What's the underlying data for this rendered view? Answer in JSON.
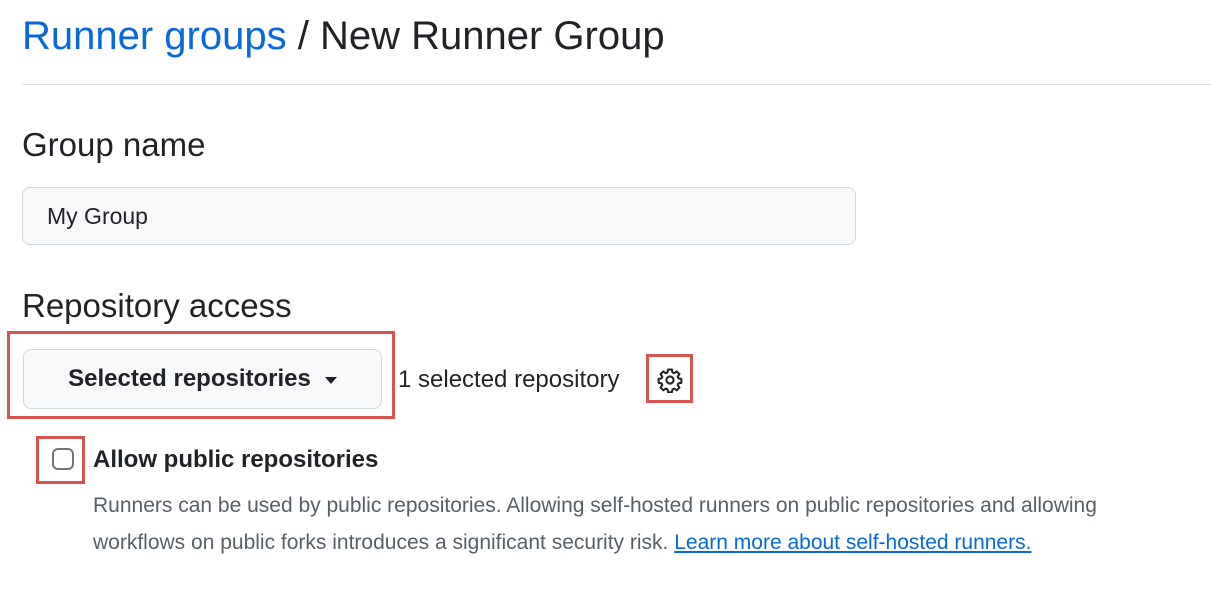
{
  "breadcrumb": {
    "parent": "Runner groups",
    "separator": " / ",
    "current": "New Runner Group"
  },
  "group_name": {
    "title": "Group name",
    "value": "My Group"
  },
  "repository_access": {
    "title": "Repository access",
    "select_label": "Selected repositories",
    "selected_count": "1 selected repository",
    "settings_icon": "gear-icon",
    "dropdown_icon": "caret-down-icon"
  },
  "public_repos": {
    "label": "Allow public repositories",
    "checked": false,
    "help_text": "Runners can be used by public repositories. Allowing self-hosted runners on public repositories and allowing workflows on public forks introduces a significant security risk. ",
    "learn_more": "Learn more about self-hosted runners."
  },
  "colors": {
    "link": "#0969da",
    "text": "#1f2328",
    "muted": "#57606a",
    "highlight": "#d9534f",
    "input_bg": "#f6f8fa",
    "border": "#d0d7de"
  }
}
